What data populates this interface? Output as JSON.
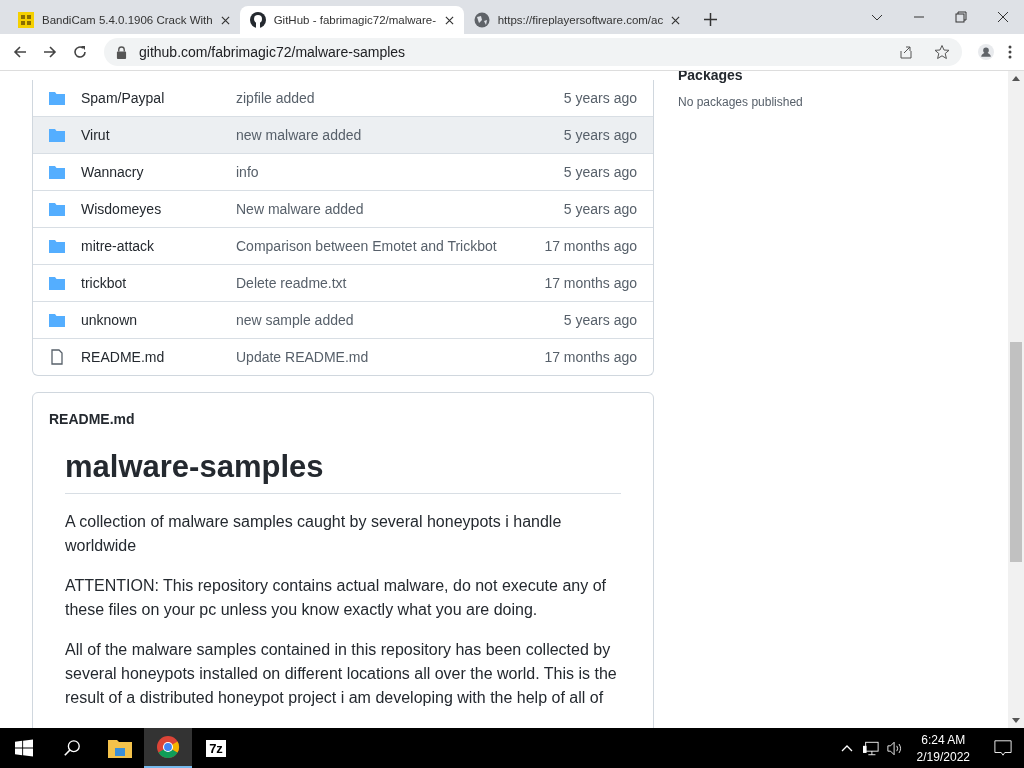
{
  "browser": {
    "tabs": [
      {
        "title": "BandiCam 5.4.0.1906 Crack With",
        "selected": false
      },
      {
        "title": "GitHub - fabrimagic72/malware-",
        "selected": true
      },
      {
        "title": "https://fireplayersoftware.com/ac",
        "selected": false
      }
    ],
    "address": "github.com/fabrimagic72/malware-samples"
  },
  "files": [
    {
      "kind": "folder",
      "name": "Spam/Paypal",
      "message": "zipfile added",
      "age": "5 years ago",
      "highlighted": false
    },
    {
      "kind": "folder",
      "name": "Virut",
      "message": "new malware added",
      "age": "5 years ago",
      "highlighted": true
    },
    {
      "kind": "folder",
      "name": "Wannacry",
      "message": "info",
      "age": "5 years ago",
      "highlighted": false
    },
    {
      "kind": "folder",
      "name": "Wisdomeyes",
      "message": "New malware added",
      "age": "5 years ago",
      "highlighted": false
    },
    {
      "kind": "folder",
      "name": "mitre-attack",
      "message": "Comparison between Emotet and Trickbot",
      "age": "17 months ago",
      "highlighted": false
    },
    {
      "kind": "folder",
      "name": "trickbot",
      "message": "Delete readme.txt",
      "age": "17 months ago",
      "highlighted": false
    },
    {
      "kind": "folder",
      "name": "unknown",
      "message": "new sample added",
      "age": "5 years ago",
      "highlighted": false
    },
    {
      "kind": "file",
      "name": "README.md",
      "message": "Update README.md",
      "age": "17 months ago",
      "highlighted": false
    }
  ],
  "readme": {
    "filename": "README.md",
    "title": "malware-samples",
    "paragraphs": [
      "A collection of malware samples caught by several honeypots i handle worldwide",
      "ATTENTION: This repository contains actual malware, do not execute any of these files on your pc unless you know exactly what you are doing.",
      "All of the malware samples contained in this repository has been collected by several honeypots installed on different locations all over the world. This is the result of a distributed honeypot project i am developing with the help of all of"
    ]
  },
  "sidebar": {
    "heading": "Packages",
    "note": "No packages published"
  },
  "taskbar": {
    "apps": [
      {
        "kind": "explorer",
        "selected": false
      },
      {
        "kind": "chrome",
        "selected": true
      },
      {
        "kind": "sevenzip",
        "label": "7z",
        "selected": false
      }
    ],
    "time": "6:24 AM",
    "date": "2/19/2022"
  }
}
